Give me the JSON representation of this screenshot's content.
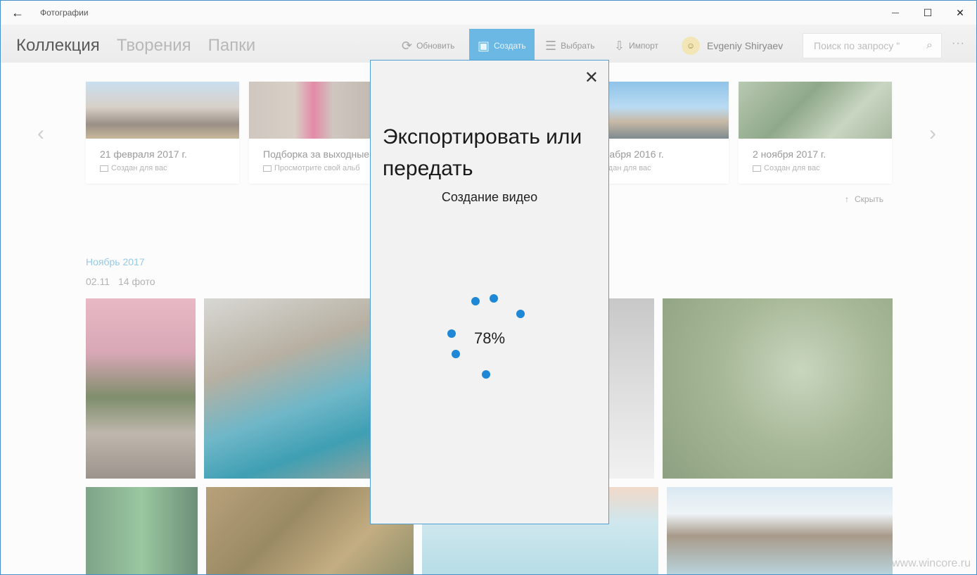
{
  "titlebar": {
    "back_icon": "←",
    "app_title": "Фотографии",
    "minimize_icon": "—",
    "maximize_icon": "☐",
    "close_icon": "✕"
  },
  "nav": {
    "tabs": [
      {
        "label": "Коллекция",
        "active": true
      },
      {
        "label": "Творения",
        "active": false
      },
      {
        "label": "Папки",
        "active": false
      }
    ]
  },
  "commands": {
    "refresh_label": "Обновить",
    "create_label": "Создать",
    "select_label": "Выбрать",
    "import_label": "Импорт",
    "user_name": "Evgeniy Shiryaev",
    "search_placeholder": "Поиск по запросу \"",
    "more_icon": "···"
  },
  "albums": [
    {
      "date": "21 февраля 2017 г.",
      "subtitle": "Создан для вас"
    },
    {
      "date": "Подборка за выходные",
      "subtitle": "Просмотрите свой альб"
    },
    {
      "date": "кабря 2016 г.",
      "subtitle": "здан для вас"
    },
    {
      "date": "2 ноября 2017 г.",
      "subtitle": "Создан для вас"
    }
  ],
  "hide_label": "Скрыть",
  "gallery": {
    "month": "Ноябрь 2017",
    "day": "02.11",
    "count": "14 фото"
  },
  "dialog": {
    "close_icon": "✕",
    "heading": "Экспортировать или передать",
    "status": "Создание видео",
    "progress": "78%"
  },
  "watermark": "www.wincore.ru",
  "colors": {
    "accent": "#1e88d6",
    "create_button": "#6bb8e4",
    "dialog_border": "#4d9fd4"
  }
}
